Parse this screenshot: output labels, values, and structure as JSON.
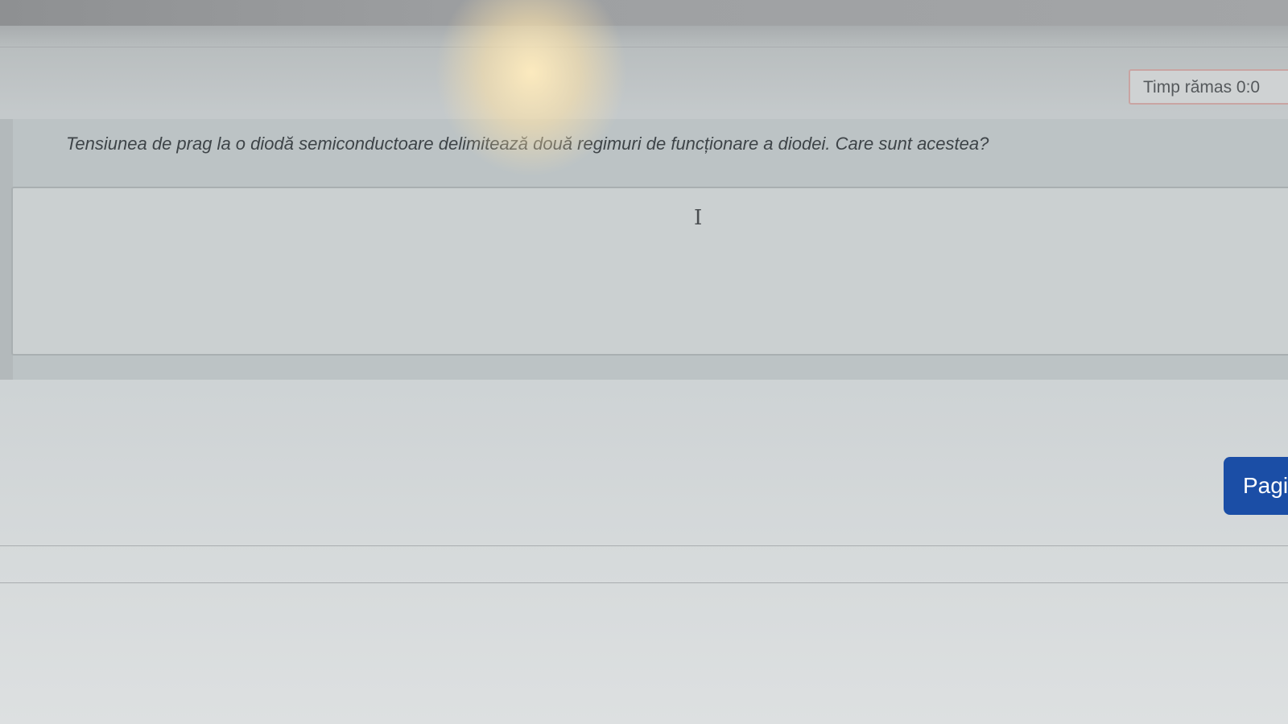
{
  "timer": {
    "label": "Timp rămas 0:0"
  },
  "question": {
    "text": "Tensiunea de prag la o diodă semiconductoare  delimitează două regimuri de funcționare a diodei. Care sunt acestea?"
  },
  "answer": {
    "value": "",
    "cursor_glyph": "I"
  },
  "navigation": {
    "next_label": "Pagi"
  },
  "colors": {
    "button_accent": "#1b4ea6",
    "timer_border": "#c9a4a2"
  }
}
